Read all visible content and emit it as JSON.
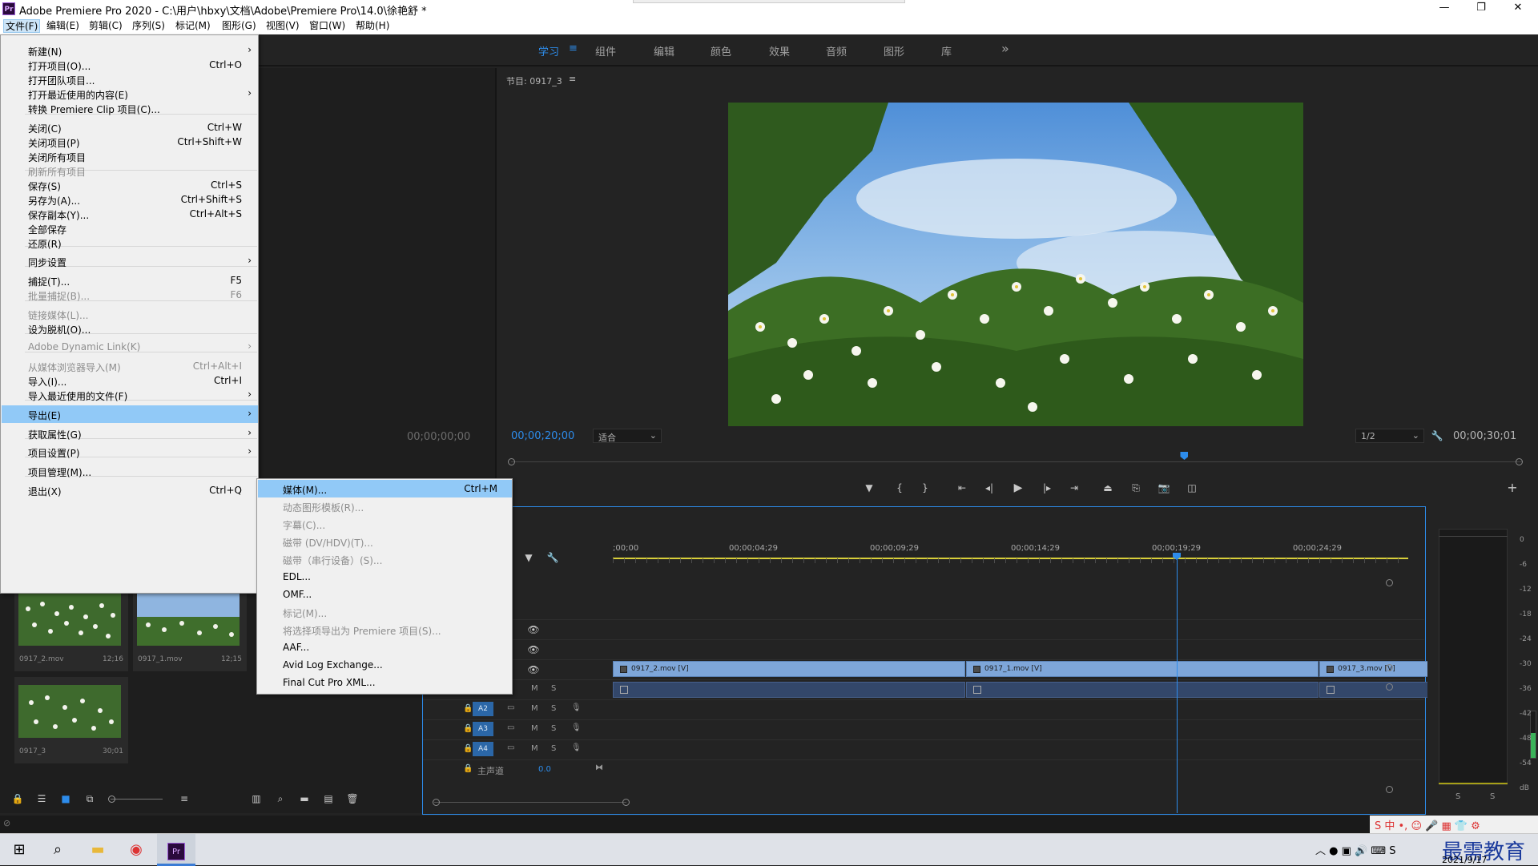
{
  "window": {
    "title": "Adobe Premiere Pro 2020 - C:\\用户\\hbxy\\文档\\Adobe\\Premiere Pro\\14.0\\徐艳舒 *",
    "app_icon": "Pr",
    "controls": {
      "minimize": "—",
      "maximize": "❐",
      "close": "✕"
    }
  },
  "menubar": [
    {
      "label": "文件(F)"
    },
    {
      "label": "编辑(E)"
    },
    {
      "label": "剪辑(C)"
    },
    {
      "label": "序列(S)"
    },
    {
      "label": "标记(M)"
    },
    {
      "label": "图形(G)"
    },
    {
      "label": "视图(V)"
    },
    {
      "label": "窗口(W)"
    },
    {
      "label": "帮助(H)"
    }
  ],
  "workspaces": {
    "tabs": [
      {
        "label": "学习"
      },
      {
        "label": "组件"
      },
      {
        "label": "编辑"
      },
      {
        "label": "颜色"
      },
      {
        "label": "效果"
      },
      {
        "label": "音频"
      },
      {
        "label": "图形"
      },
      {
        "label": "库"
      }
    ],
    "menu_glyph": "≡",
    "more_glyph": "»"
  },
  "file_menu": [
    {
      "label": "新建(N)",
      "shortcut": "",
      "submenu": true,
      "disabled": false
    },
    {
      "label": "打开项目(O)...",
      "shortcut": "Ctrl+O",
      "submenu": false,
      "disabled": false
    },
    {
      "label": "打开团队项目...",
      "shortcut": "",
      "submenu": false,
      "disabled": false
    },
    {
      "label": "打开最近使用的内容(E)",
      "shortcut": "",
      "submenu": true,
      "disabled": false
    },
    {
      "label": "转换 Premiere Clip 项目(C)...",
      "shortcut": "",
      "submenu": false,
      "disabled": false
    },
    {
      "label": "关闭(C)",
      "shortcut": "Ctrl+W",
      "submenu": false,
      "disabled": false
    },
    {
      "label": "关闭项目(P)",
      "shortcut": "Ctrl+Shift+W",
      "submenu": false,
      "disabled": false
    },
    {
      "label": "关闭所有项目",
      "shortcut": "",
      "submenu": false,
      "disabled": false
    },
    {
      "label": "刷新所有项目",
      "shortcut": "",
      "submenu": false,
      "disabled": true
    },
    {
      "label": "保存(S)",
      "shortcut": "Ctrl+S",
      "submenu": false,
      "disabled": false
    },
    {
      "label": "另存为(A)...",
      "shortcut": "Ctrl+Shift+S",
      "submenu": false,
      "disabled": false
    },
    {
      "label": "保存副本(Y)...",
      "shortcut": "Ctrl+Alt+S",
      "submenu": false,
      "disabled": false
    },
    {
      "label": "全部保存",
      "shortcut": "",
      "submenu": false,
      "disabled": false
    },
    {
      "label": "还原(R)",
      "shortcut": "",
      "submenu": false,
      "disabled": false
    },
    {
      "label": "同步设置",
      "shortcut": "",
      "submenu": true,
      "disabled": false
    },
    {
      "label": "捕捉(T)...",
      "shortcut": "F5",
      "submenu": false,
      "disabled": false
    },
    {
      "label": "批量捕捉(B)...",
      "shortcut": "F6",
      "submenu": false,
      "disabled": true
    },
    {
      "label": "链接媒体(L)...",
      "shortcut": "",
      "submenu": false,
      "disabled": true
    },
    {
      "label": "设为脱机(O)...",
      "shortcut": "",
      "submenu": false,
      "disabled": false
    },
    {
      "label": "Adobe Dynamic Link(K)",
      "shortcut": "",
      "submenu": true,
      "disabled": true
    },
    {
      "label": "从媒体浏览器导入(M)",
      "shortcut": "Ctrl+Alt+I",
      "submenu": false,
      "disabled": true
    },
    {
      "label": "导入(I)...",
      "shortcut": "Ctrl+I",
      "submenu": false,
      "disabled": false
    },
    {
      "label": "导入最近使用的文件(F)",
      "shortcut": "",
      "submenu": true,
      "disabled": false
    },
    {
      "label": "导出(E)",
      "shortcut": "",
      "submenu": true,
      "disabled": false,
      "highlighted": true
    },
    {
      "label": "获取属性(G)",
      "shortcut": "",
      "submenu": true,
      "disabled": false
    },
    {
      "label": "项目设置(P)",
      "shortcut": "",
      "submenu": true,
      "disabled": false
    },
    {
      "label": "项目管理(M)...",
      "shortcut": "",
      "submenu": false,
      "disabled": false
    },
    {
      "label": "退出(X)",
      "shortcut": "Ctrl+Q",
      "submenu": false,
      "disabled": false
    }
  ],
  "export_menu": [
    {
      "label": "媒体(M)...",
      "shortcut": "Ctrl+M",
      "disabled": false,
      "highlighted": true
    },
    {
      "label": "动态图形模板(R)...",
      "shortcut": "",
      "disabled": true
    },
    {
      "label": "字幕(C)...",
      "shortcut": "",
      "disabled": true
    },
    {
      "label": "磁带 (DV/HDV)(T)...",
      "shortcut": "",
      "disabled": true
    },
    {
      "label": "磁带（串行设备）(S)...",
      "shortcut": "",
      "disabled": true
    },
    {
      "label": "EDL...",
      "shortcut": "",
      "disabled": false
    },
    {
      "label": "OMF...",
      "shortcut": "",
      "disabled": false
    },
    {
      "label": "标记(M)...",
      "shortcut": "",
      "disabled": true
    },
    {
      "label": "将选择项导出为 Premiere 项目(S)...",
      "shortcut": "",
      "disabled": true
    },
    {
      "label": "AAF...",
      "shortcut": "",
      "disabled": false
    },
    {
      "label": "Avid Log Exchange...",
      "shortcut": "",
      "disabled": false
    },
    {
      "label": "Final Cut Pro XML...",
      "shortcut": "",
      "disabled": false
    }
  ],
  "source_monitor": {
    "timecode": "00;00;00;00"
  },
  "program_monitor": {
    "title": "节目: 0917_3",
    "menu_glyph": "≡",
    "current_timecode": "00;00;20;00",
    "fit_label": "适合",
    "resolution": "1/2",
    "duration": "00;00;30;01",
    "playhead_fraction": 0.666
  },
  "project_bin": {
    "clips": [
      {
        "name": "0917_2.mov",
        "duration": "12;16"
      },
      {
        "name": "0917_1.mov",
        "duration": "12;15"
      },
      {
        "name": "0917_3",
        "duration": "30;01"
      }
    ]
  },
  "timeline": {
    "ruler_labels": [
      ";00;00",
      "00;00;04;29",
      "00;00;09;29",
      "00;00;14;29",
      "00;00;19;29",
      "00;00;24;29"
    ],
    "video_clips": [
      {
        "name": "0917_2.mov [V]",
        "start": 0,
        "end": 12.53
      },
      {
        "name": "0917_1.mov [V]",
        "start": 12.53,
        "end": 25.06
      },
      {
        "name": "0917_3.mov [V]",
        "start": 25.06,
        "end": 30.03
      }
    ],
    "audio_tracks": [
      {
        "name": "A2",
        "m": "M",
        "s": "S"
      },
      {
        "name": "A3",
        "m": "M",
        "s": "S"
      },
      {
        "name": "A4",
        "m": "M",
        "s": "S"
      }
    ],
    "master": {
      "label": "主声道",
      "value": "0.0"
    },
    "playhead_seconds": 20
  },
  "audio_meter": {
    "scale": [
      "0",
      "-6",
      "-12",
      "-18",
      "-24",
      "-30",
      "-36",
      "-42",
      "-48",
      "-54",
      "dB"
    ],
    "solo": [
      "S",
      "S"
    ]
  },
  "taskbar": {
    "date": "2021/9/17",
    "watermark": "最需教育"
  },
  "colors": {
    "accent": "#2d8ceb",
    "menu_highlight": "#91c9f7",
    "video_clip": "#7ea6d9",
    "audio_clip": "#33476a",
    "panel_bg": "#232323"
  }
}
